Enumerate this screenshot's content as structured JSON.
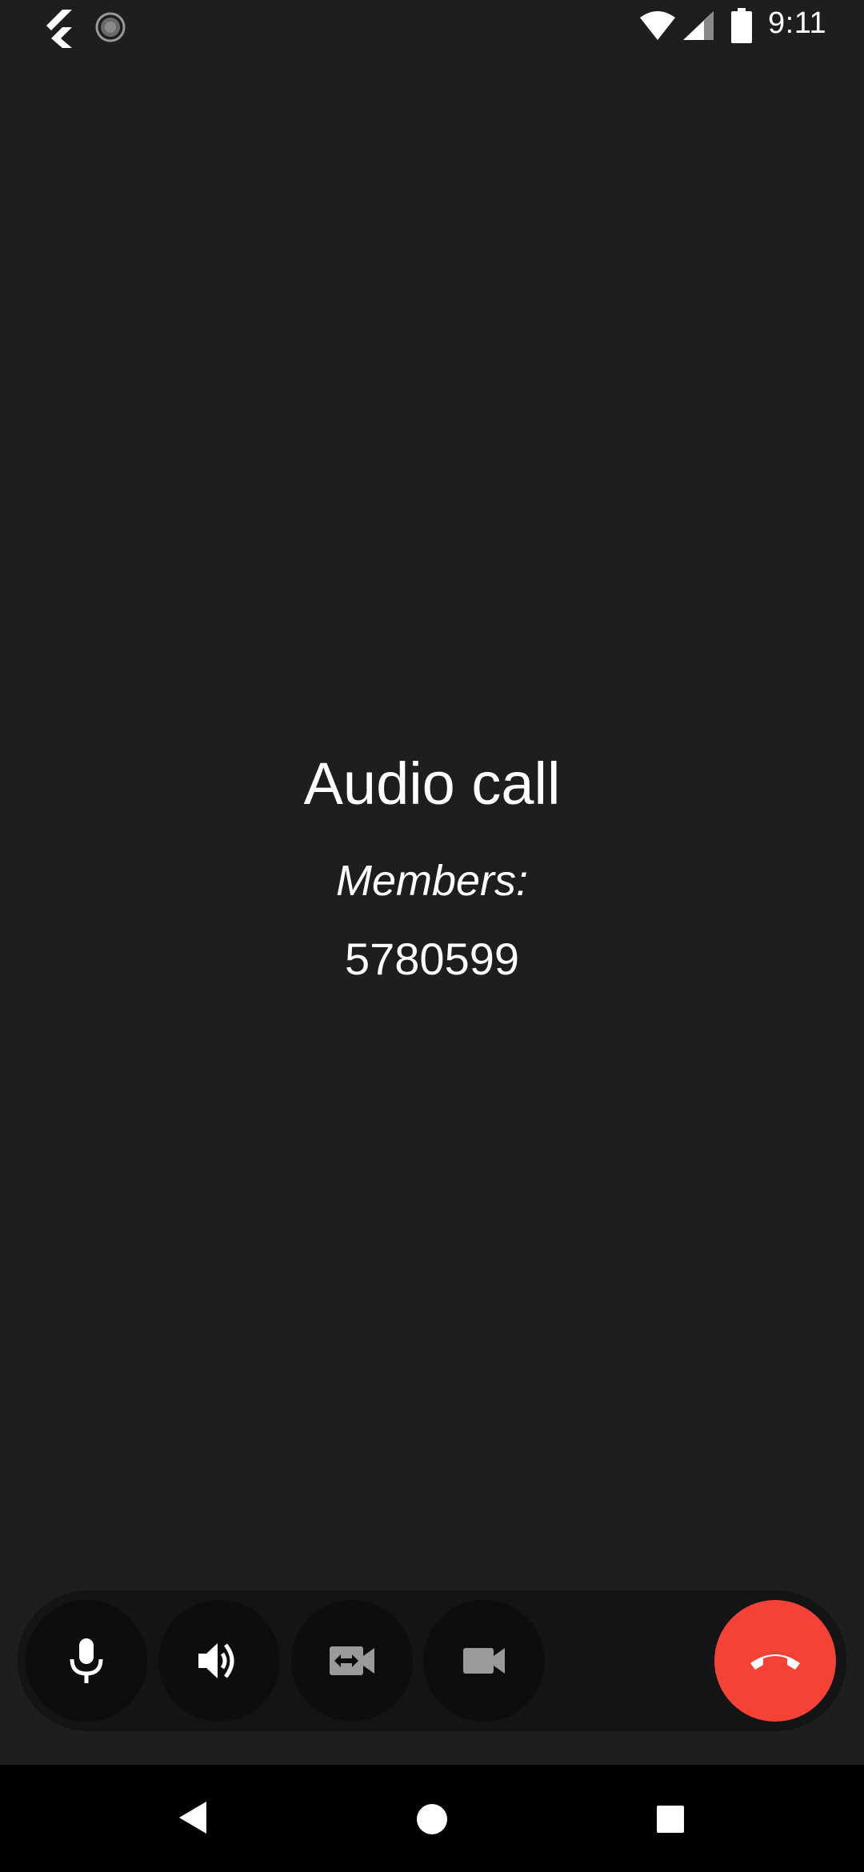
{
  "status_bar": {
    "time": "9:11",
    "icons": [
      "flutter-icon",
      "loading-spinner-icon",
      "wifi-icon",
      "cell-signal-icon",
      "battery-icon"
    ]
  },
  "call": {
    "title": "Audio call",
    "members_label": "Members:",
    "members_value": "5780599"
  },
  "controls": {
    "buttons": [
      "microphone-icon",
      "speaker-icon",
      "switch-camera-icon",
      "video-camera-icon",
      "hang-up-icon"
    ],
    "hangup_color": "#f44336"
  },
  "nav_bar": {
    "buttons": [
      "back-icon",
      "home-icon",
      "recents-icon"
    ]
  },
  "colors": {
    "background": "#1c1e20",
    "control_bar": "#131415",
    "control_button": "#0c0d0e"
  }
}
